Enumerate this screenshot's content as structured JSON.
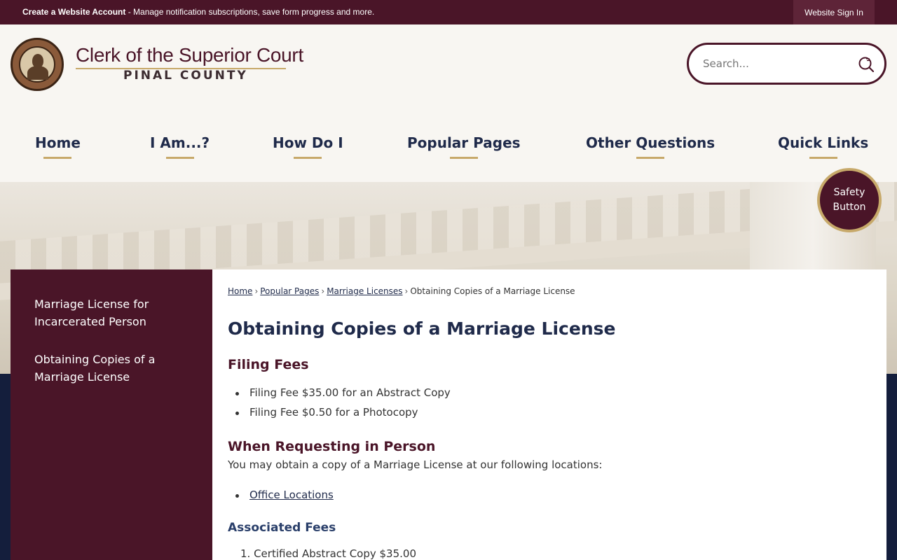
{
  "topbar": {
    "create_account": "Create a Website Account",
    "message": " - Manage notification subscriptions, save form progress and more.",
    "signin": "Website Sign In"
  },
  "brand": {
    "title": "Clerk of the Superior Court",
    "subtitle": "PINAL COUNTY"
  },
  "search": {
    "placeholder": "Search..."
  },
  "nav": [
    {
      "label": "Home"
    },
    {
      "label": "I Am...?"
    },
    {
      "label": "How Do I"
    },
    {
      "label": "Popular Pages"
    },
    {
      "label": "Other Questions"
    },
    {
      "label": "Quick Links"
    }
  ],
  "safety_button": {
    "line1": "Safety",
    "line2": "Button"
  },
  "sidebar": {
    "items": [
      {
        "label": "Marriage License for Incarcerated Person"
      },
      {
        "label": "Obtaining Copies of a Marriage License"
      }
    ]
  },
  "breadcrumb": {
    "items": [
      "Home",
      "Popular Pages",
      "Marriage Licenses"
    ],
    "current": "Obtaining Copies of a Marriage License",
    "separator": "›"
  },
  "content": {
    "title": "Obtaining Copies of a Marriage License",
    "filing_fees_heading": "Filing Fees",
    "filing_fees": [
      "Filing Fee $35.00 for an Abstract Copy",
      "Filing Fee $0.50 for a Photocopy"
    ],
    "in_person_heading": "When Requesting in Person",
    "in_person_text": "You may obtain a copy of a Marriage License at our following locations:",
    "office_locations_link": "Office Locations",
    "associated_fees_heading": "Associated Fees",
    "associated_fees": [
      "1. Certified Abstract Copy $35.00"
    ]
  },
  "colors": {
    "maroon": "#4a1528",
    "navy": "#1f2a4a",
    "gold": "#c7a96a"
  }
}
